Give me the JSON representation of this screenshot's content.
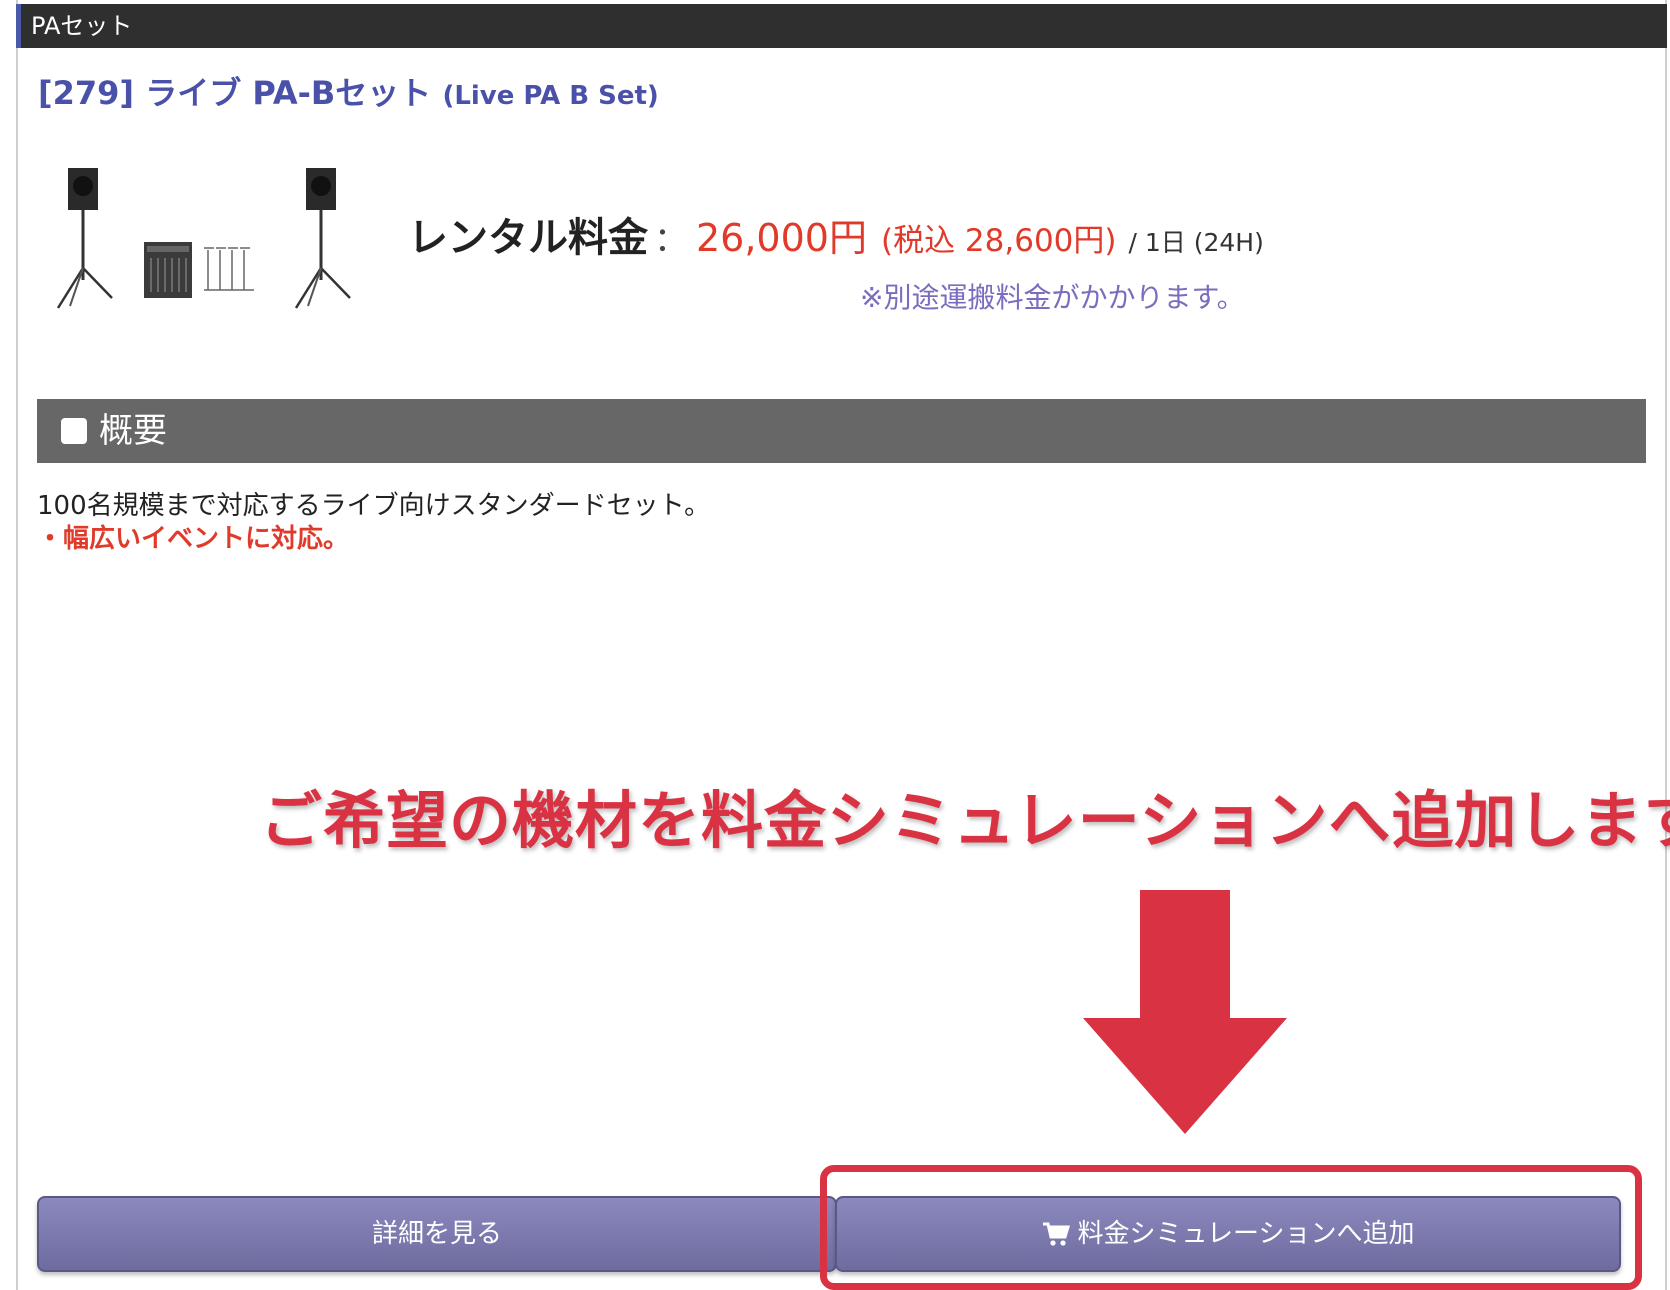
{
  "category": {
    "label": "PAセット"
  },
  "product": {
    "title": "[279] ライブ PA-Bセット",
    "title_en": "(Live PA B Set)",
    "image_alt": "ライブ PA-Bセット"
  },
  "pricing": {
    "label": "レンタル料金",
    "separator": "：",
    "price": "26,000円",
    "price_with_tax": "(税込 28,600円)",
    "unit": "/ 1日 (24H)",
    "shipping_note": "※別途運搬料金がかかります。"
  },
  "overview": {
    "heading": "概要",
    "description": "100名規模まで対応するライブ向けスタンダードセット。",
    "highlight": "・幅広いイベントに対応。"
  },
  "annotation": {
    "text": "ご希望の機材を料金シミュレーションへ追加します",
    "color": "#d93243"
  },
  "buttons": {
    "detail_label": "詳細を見る",
    "add_sim_label": "料金シミュレーションへ追加",
    "add_sim_icon": "cart-icon"
  },
  "colors": {
    "accent": "#4a51a8",
    "price": "#e03a2a",
    "button": "#7b79ad",
    "section_header": "#676767",
    "category_bar": "#2f2f2f"
  }
}
